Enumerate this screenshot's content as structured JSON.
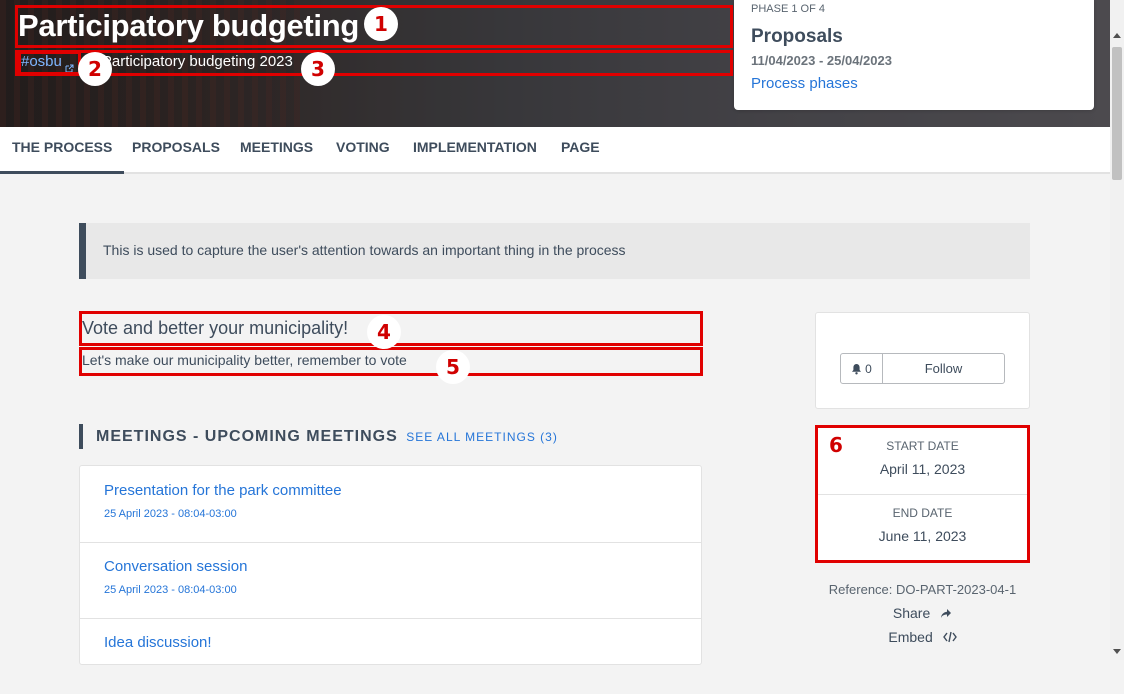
{
  "hero": {
    "title": "Participatory budgeting",
    "hashtag": "#osbu",
    "subtitle": "Participatory budgeting 2023"
  },
  "phase": {
    "step": "PHASE 1 OF 4",
    "name": "Proposals",
    "dates": "11/04/2023 - 25/04/2023",
    "link": "Process phases"
  },
  "tabs": [
    {
      "label": "THE PROCESS",
      "active": true
    },
    {
      "label": "PROPOSALS"
    },
    {
      "label": "MEETINGS"
    },
    {
      "label": "VOTING"
    },
    {
      "label": "IMPLEMENTATION"
    },
    {
      "label": "PAGE"
    }
  ],
  "announcement": {
    "text": "This is used to capture the user's attention towards an important thing in the process"
  },
  "description": {
    "title": "Vote and better your municipality!",
    "text": "Let's make our municipality better, remember to vote"
  },
  "meetings": {
    "title": "MEETINGS - UPCOMING MEETINGS",
    "see_all": "SEE ALL MEETINGS (3)",
    "items": [
      {
        "title": "Presentation for the park committee",
        "date": "25 April 2023 - 08:04-03:00"
      },
      {
        "title": "Conversation session",
        "date": "25 April 2023 - 08:04-03:00"
      },
      {
        "title": "Idea discussion!",
        "date": ""
      }
    ]
  },
  "follow": {
    "count": "0",
    "label": "Follow"
  },
  "dates": {
    "start_label": "START DATE",
    "start_value": "April 11, 2023",
    "end_label": "END DATE",
    "end_value": "June 11, 2023"
  },
  "reference": "Reference: DO-PART-2023-04-1",
  "share_label": "Share",
  "embed_label": "Embed",
  "annotations": [
    "1",
    "2",
    "3",
    "4",
    "5",
    "6"
  ],
  "colors": {
    "primary_text": "#3e4c5c",
    "link": "#2575d8",
    "annotation": "#e00000"
  }
}
